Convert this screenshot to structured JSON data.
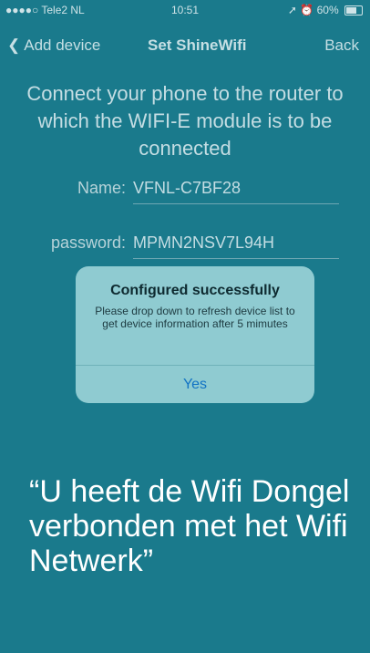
{
  "status_bar": {
    "carrier": "●●●●○ Tele2 NL",
    "time": "10:51",
    "battery": "60%"
  },
  "nav": {
    "back_label": "Add device",
    "title": "Set ShineWifi",
    "right_label": "Back"
  },
  "instruction": "Connect your phone to the router to which the WIFI-E module is to be connected",
  "fields": {
    "name_label": "Name:",
    "name_value": "VFNL-C7BF28",
    "password_label": "password:",
    "password_value": "MPMN2NSV7L94H"
  },
  "dialog": {
    "title": "Configured successfully",
    "message": "Please drop down  to refresh device list to get device information after 5 mimutes",
    "button": "Yes"
  },
  "caption": "“U heeft de Wifi Dongel verbonden met het Wifi Netwerk”"
}
